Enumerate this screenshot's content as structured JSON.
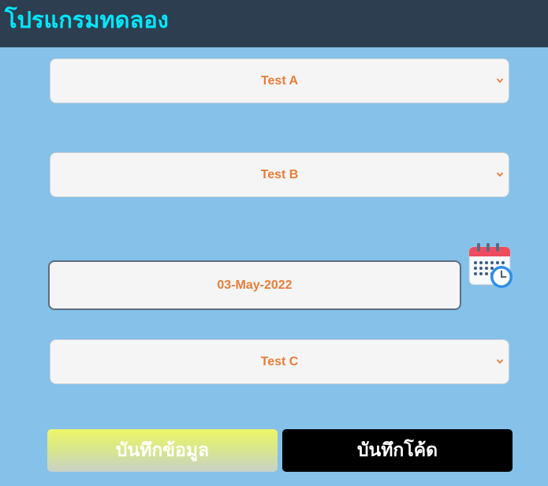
{
  "header": {
    "title": "โปรแกรมทดลอง"
  },
  "form": {
    "select_a": {
      "value": "Test A"
    },
    "select_b": {
      "value": "Test B"
    },
    "date": {
      "value": "03-May-2022"
    },
    "select_c": {
      "value": "Test C"
    }
  },
  "buttons": {
    "save_data_label": "บันทึกข้อมูล",
    "save_code_label": "บันทึกโค้ด"
  },
  "icons": {
    "calendar": "calendar-clock-icon",
    "dropdown": "chevron-down-icon"
  },
  "colors": {
    "background": "#85c1e9",
    "header": "#2c3e50",
    "title": "#00e8ff",
    "value_text": "#e67e3a"
  }
}
